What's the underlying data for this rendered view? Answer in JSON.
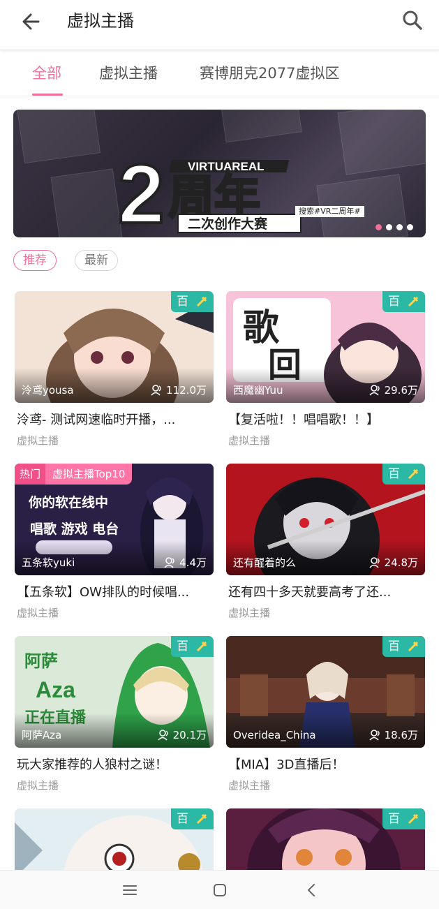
{
  "header": {
    "title": "虚拟主播"
  },
  "tabs": [
    {
      "label": "全部"
    },
    {
      "label": "虚拟主播"
    },
    {
      "label": "赛博朋克2077虚拟区"
    }
  ],
  "banner": {
    "brand": "VIRTUAREAL",
    "big_text": "2周年",
    "subtitle": "二次创作大赛",
    "hashtag": "搜索#VR二周年#",
    "slide_count": 4,
    "active_slide": 1
  },
  "filters": [
    {
      "label": "推荐"
    },
    {
      "label": "最新"
    }
  ],
  "badge_text": "百",
  "cards": [
    {
      "anchor": "泠鸢yousa",
      "views": "112.0万",
      "title": "泠鸢- 测试网速临时开播，...",
      "category": "虚拟主播",
      "thumb_color": "#f3e2d6"
    },
    {
      "anchor": "西魔幽Yuu",
      "views": "29.6万",
      "title": "【复活啦！！唱唱歌！！】",
      "category": "虚拟主播",
      "thumb_color": "#f7c3d8",
      "thumb_text": "歌回"
    },
    {
      "anchor": "五条软yuki",
      "views": "4.4万",
      "title": "【五条软】OW排队的时候唱...",
      "category": "虚拟主播",
      "thumb_color": "#2a1f45",
      "hot": "热门",
      "rank": "虚拟主播Top10",
      "thumb_text": "你的软在线中 唱歌 游戏 电台"
    },
    {
      "anchor": "还有醒着的么",
      "views": "24.8万",
      "title": "还有四十多天就要高考了还...",
      "category": "虚拟主播",
      "thumb_color": "#b3141e"
    },
    {
      "anchor": "阿萨Aza",
      "views": "20.1万",
      "title": "玩大家推荐的人狼村之谜！",
      "category": "虚拟主播",
      "thumb_color": "#dbe9d9",
      "thumb_text": "阿萨 Aza 正在直播"
    },
    {
      "anchor": "Overidea_China",
      "views": "18.6万",
      "title": "【MIA】3D直播后！",
      "category": "虚拟主播",
      "thumb_color": "#6b3b2d"
    },
    {
      "anchor": "",
      "views": "",
      "title": "",
      "category": "",
      "thumb_color": "#e3eef3"
    },
    {
      "anchor": "",
      "views": "",
      "title": "",
      "category": "",
      "thumb_color": "#5a1e3e"
    }
  ],
  "colors": {
    "accent": "#f0709a",
    "badge": "#2bb8a4",
    "hot": "#f04f88"
  },
  "icons": {
    "back": "arrow-left-icon",
    "search": "search-icon",
    "views": "people-icon",
    "nav_menu": "menu-icon",
    "nav_home": "square-icon",
    "nav_back": "chevron-left-icon"
  }
}
